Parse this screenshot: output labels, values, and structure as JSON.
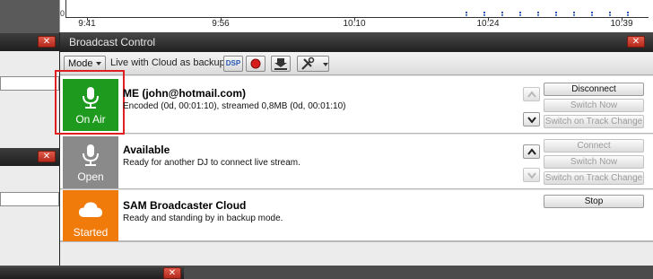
{
  "chart": {
    "zero_label": "0",
    "times": [
      "9:41",
      "9:56",
      "10:10",
      "10:24",
      "10:39"
    ]
  },
  "broadcast": {
    "title": "Broadcast Control",
    "close": "✕",
    "toolbar": {
      "mode_label": "Mode",
      "status_text": "Live with Cloud as backup",
      "dsp_label": "DSP"
    },
    "rows": [
      {
        "tile_label": "On Air",
        "tile_color": "#1e9a1e",
        "name": "ME (john@hotmail.com)",
        "desc": "Encoded (0d, 00:01:10), streamed 0,8MB (0d, 00:01:10)",
        "buttons": [
          "Disconnect",
          "Switch Now",
          "Switch on Track Change"
        ]
      },
      {
        "tile_label": "Open",
        "tile_color": "#8a8a8a",
        "name": "Available",
        "desc": "Ready for another DJ to connect live stream.",
        "buttons": [
          "Connect",
          "Switch Now",
          "Switch on Track Change"
        ]
      },
      {
        "tile_label": "Started",
        "tile_color": "#f07a0a",
        "name": "SAM Broadcaster Cloud",
        "desc": "Ready and standing by in backup mode.",
        "buttons": [
          "Stop"
        ]
      }
    ]
  },
  "colors": {
    "highlight": "#e02020",
    "on_air": "#1e9a1e",
    "open": "#8a8a8a",
    "started": "#f07a0a"
  }
}
